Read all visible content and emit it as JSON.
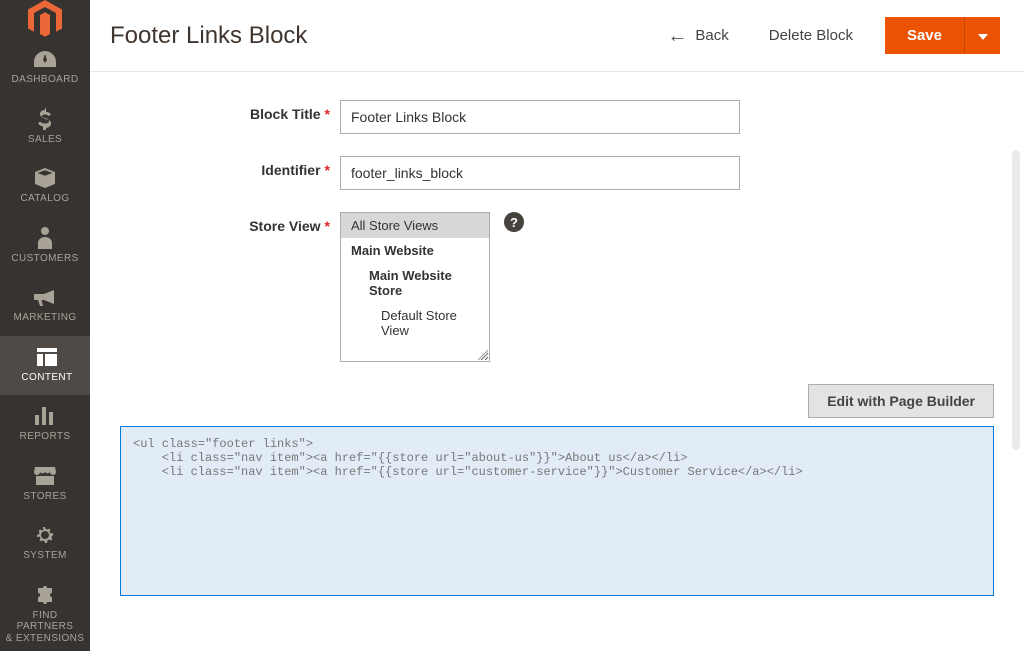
{
  "sidebar": {
    "items": [
      {
        "label": "DASHBOARD",
        "icon": "gauge-icon"
      },
      {
        "label": "SALES",
        "icon": "dollar-icon"
      },
      {
        "label": "CATALOG",
        "icon": "package-icon"
      },
      {
        "label": "CUSTOMERS",
        "icon": "person-icon"
      },
      {
        "label": "MARKETING",
        "icon": "megaphone-icon"
      },
      {
        "label": "CONTENT",
        "icon": "layout-icon",
        "active": true
      },
      {
        "label": "REPORTS",
        "icon": "bars-icon"
      },
      {
        "label": "STORES",
        "icon": "store-icon"
      },
      {
        "label": "SYSTEM",
        "icon": "gear-icon"
      },
      {
        "label": "FIND PARTNERS\n& EXTENSIONS",
        "icon": "puzzle-icon"
      }
    ]
  },
  "header": {
    "title": "Footer Links Block",
    "back_label": "Back",
    "delete_label": "Delete Block",
    "save_label": "Save"
  },
  "form": {
    "block_title": {
      "label": "Block Title",
      "value": "Footer Links Block"
    },
    "identifier": {
      "label": "Identifier",
      "value": "footer_links_block"
    },
    "store_view": {
      "label": "Store View",
      "options": [
        {
          "text": "All Store Views",
          "selected": true,
          "indent": 0,
          "bold": false
        },
        {
          "text": "Main Website",
          "selected": false,
          "indent": 0,
          "bold": true
        },
        {
          "text": "Main Website Store",
          "selected": false,
          "indent": 1,
          "bold": true
        },
        {
          "text": "Default Store View",
          "selected": false,
          "indent": 2,
          "bold": false
        }
      ]
    },
    "edit_pagebuilder_label": "Edit with Page Builder",
    "content_html": "<ul class=\"footer links\">\n    <li class=\"nav item\"><a href=\"{{store url=\"about-us\"}}\">About us</a></li>\n    <li class=\"nav item\"><a href=\"{{store url=\"customer-service\"}}\">Customer Service</a></li>"
  }
}
